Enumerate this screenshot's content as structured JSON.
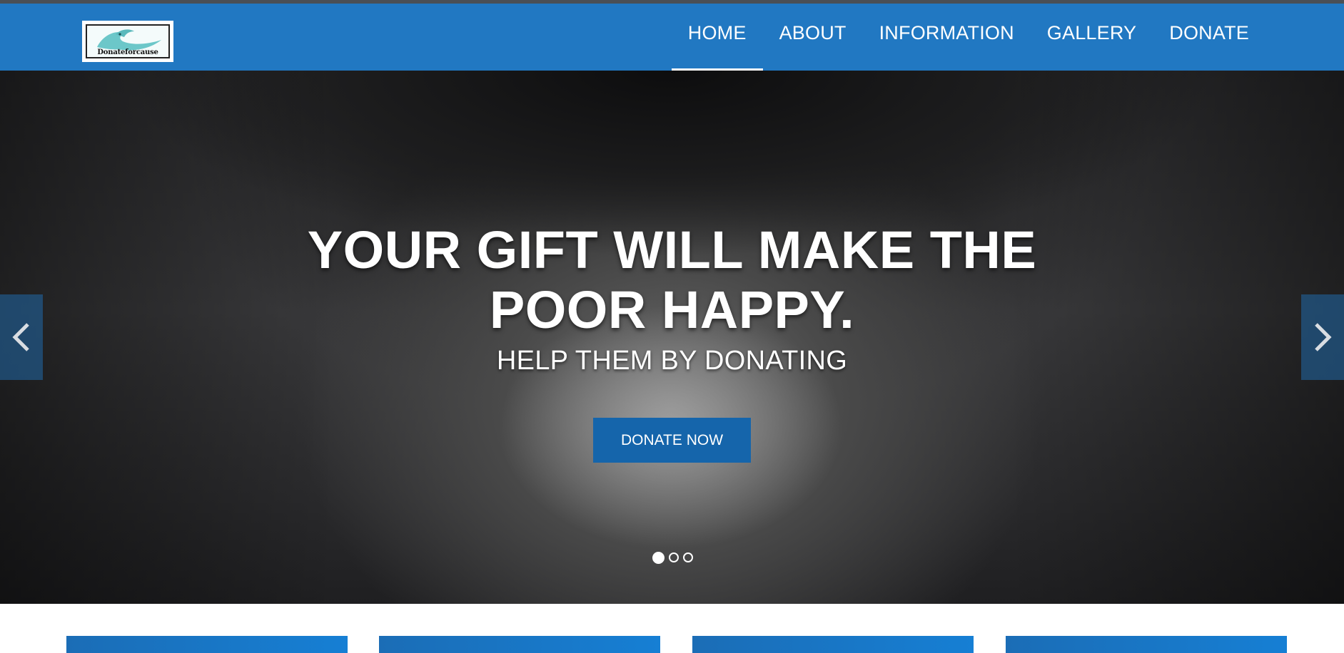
{
  "brand": {
    "logo_text": "Donateforcause"
  },
  "nav": {
    "items": [
      {
        "label": "HOME"
      },
      {
        "label": "ABOUT"
      },
      {
        "label": "INFORMATION"
      },
      {
        "label": "GALLERY"
      },
      {
        "label": "DONATE"
      }
    ],
    "active_index": 0
  },
  "hero": {
    "title": "YOUR GIFT WILL MAKE THE POOR HAPPY.",
    "subtitle": "HELP THEM BY DONATING",
    "button_label": "DONATE NOW",
    "prev_icon": "chevron-left-icon",
    "next_icon": "chevron-right-icon",
    "slides_count": 3,
    "active_slide": 0
  },
  "colors": {
    "navbar": "#2178c2",
    "button": "#1565ab",
    "card": "#1a73c4"
  }
}
